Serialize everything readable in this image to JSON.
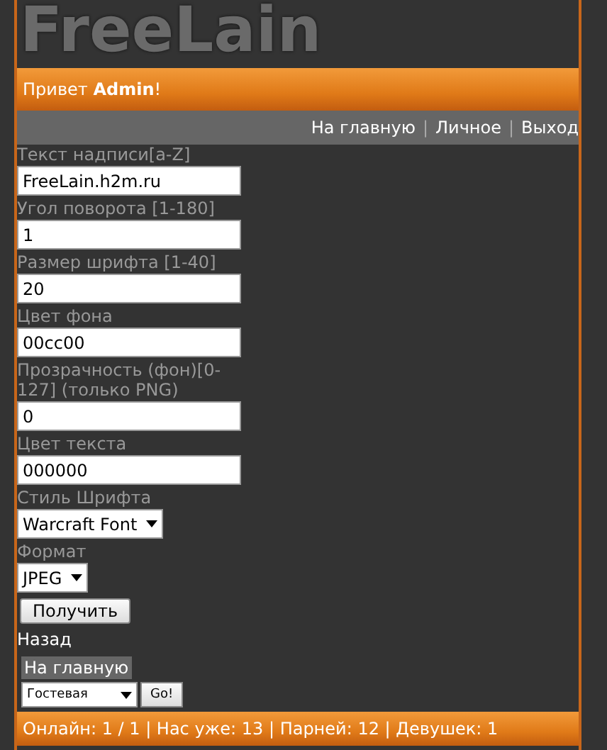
{
  "logo": "FreeLain",
  "greeting": "Привет **Admin**!",
  "nav": {
    "separator": "|",
    "links": [
      "На главную",
      "Личное",
      "Выход"
    ]
  },
  "form": {
    "fields": [
      {
        "kind": "text",
        "label": "Текст надписи[a-Z]",
        "value": "FreeLain.h2m.ru"
      },
      {
        "kind": "text",
        "label": "Угол поворота [1-180]",
        "value": "1"
      },
      {
        "kind": "text",
        "label": "Размер шрифта [1-40]",
        "value": "20"
      },
      {
        "kind": "text",
        "label": "Цвет фона",
        "value": "00cc00"
      },
      {
        "kind": "text",
        "label": "Прозрачность (фон)[0-127] (только PNG)",
        "value": "0"
      },
      {
        "kind": "text",
        "label": "Цвет текста",
        "value": "000000"
      },
      {
        "kind": "select",
        "label": "Стиль Шрифта",
        "value": "Warcraft Font"
      },
      {
        "kind": "select",
        "label": "Формат",
        "value": "JPEG"
      }
    ],
    "submit": "Получить"
  },
  "back_link": "Назад",
  "home_link": "На главную",
  "jump": {
    "value": "Гостевая",
    "button": "Go!"
  },
  "footer": "Онлайн: 1 / 1 |  Нас уже: 13 | Парней: 12 | Девушек: 1"
}
